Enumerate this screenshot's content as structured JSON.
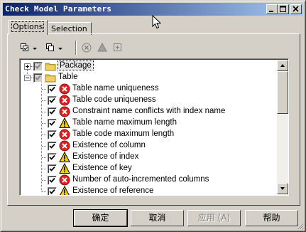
{
  "window": {
    "title": "Check Model Parameters"
  },
  "tabs": [
    {
      "label": "Options",
      "active": true
    },
    {
      "label": "Selection",
      "active": false
    }
  ],
  "toolbar": {
    "icons": [
      "select-all-dropdown-icon",
      "deselect-dropdown-icon",
      "error-filter-icon",
      "warning-filter-icon",
      "automatic-correction-icon"
    ]
  },
  "tree": {
    "rows": [
      {
        "label": "Package",
        "level": 0,
        "expander": "plus",
        "check": "grey",
        "icon": "folder-icon",
        "selected": true
      },
      {
        "label": "Table",
        "level": 0,
        "expander": "minus",
        "check": "grey",
        "icon": "folder-icon",
        "selected": false
      },
      {
        "label": "Table name uniqueness",
        "level": 1,
        "check": "checked",
        "icon": "error-icon"
      },
      {
        "label": "Table code uniqueness",
        "level": 1,
        "check": "checked",
        "icon": "error-icon"
      },
      {
        "label": "Constraint name conflicts with index name",
        "level": 1,
        "check": "checked",
        "icon": "error-icon"
      },
      {
        "label": "Table name maximum length",
        "level": 1,
        "check": "checked",
        "icon": "warning-icon"
      },
      {
        "label": "Table code maximum length",
        "level": 1,
        "check": "checked",
        "icon": "error-icon"
      },
      {
        "label": "Existence of column",
        "level": 1,
        "check": "checked",
        "icon": "error-icon"
      },
      {
        "label": "Existence of index",
        "level": 1,
        "check": "checked",
        "icon": "warning-icon"
      },
      {
        "label": "Existence of key",
        "level": 1,
        "check": "checked",
        "icon": "warning-icon"
      },
      {
        "label": "Number of auto-incremented columns",
        "level": 1,
        "check": "checked",
        "icon": "error-icon"
      },
      {
        "label": "Existence of reference",
        "level": 1,
        "check": "checked",
        "icon": "warning-icon"
      }
    ]
  },
  "buttons": {
    "ok": "确定",
    "cancel": "取消",
    "apply": "应用",
    "apply_key": "(A)",
    "help": "帮助"
  },
  "colors": {
    "title_gradient_start": "#0a246a",
    "title_gradient_end": "#a6caf0",
    "error_red": "#e02020",
    "warning_yellow": "#f5d000",
    "face": "#d4d0c8"
  }
}
